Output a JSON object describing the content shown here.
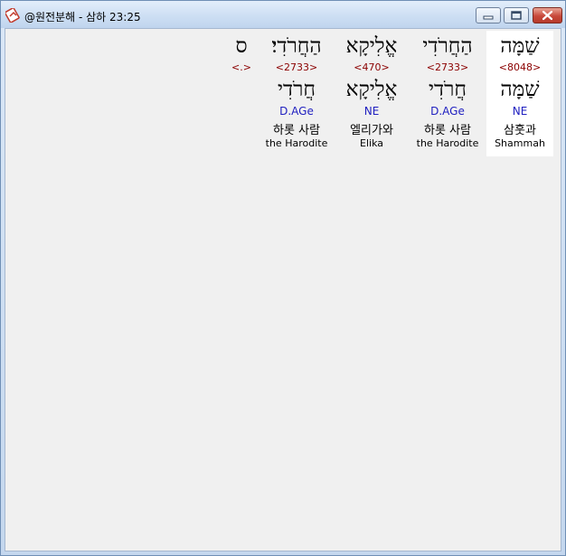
{
  "window": {
    "title": "@원전분해 - 삼하 23:25",
    "icon": "app-icon",
    "controls": [
      "minimize-icon",
      "maximize-icon",
      "close-icon"
    ]
  },
  "words": [
    {
      "surface": "שַׁמָּה",
      "strong": "<8048>",
      "lemma": "שַׁמָּה",
      "morph": "NE",
      "korean": "삼훗과",
      "english": "Shammah",
      "highlighted": true
    },
    {
      "surface": "הַחֲרֹדִי",
      "strong": "<2733>",
      "lemma": "חֲרֹדִי",
      "morph": "D.AGe",
      "korean": "하롯 사람",
      "english": "the Harodite",
      "highlighted": false
    },
    {
      "surface": "אֱלִיקָא",
      "strong": "<470>",
      "lemma": "אֱלִיקָא",
      "morph": "NE",
      "korean": "엘리가와",
      "english": "Elika",
      "highlighted": false
    },
    {
      "surface": "הַחֲרֹדִי׃",
      "strong": "<2733>",
      "lemma": "חֲרֹדִי",
      "morph": "D.AGe",
      "korean": "하롯 사람",
      "english": "the Harodite",
      "highlighted": false
    },
    {
      "surface": "ס",
      "strong": "<.>",
      "lemma": "",
      "morph": "",
      "korean": "",
      "english": "",
      "highlighted": false
    }
  ]
}
